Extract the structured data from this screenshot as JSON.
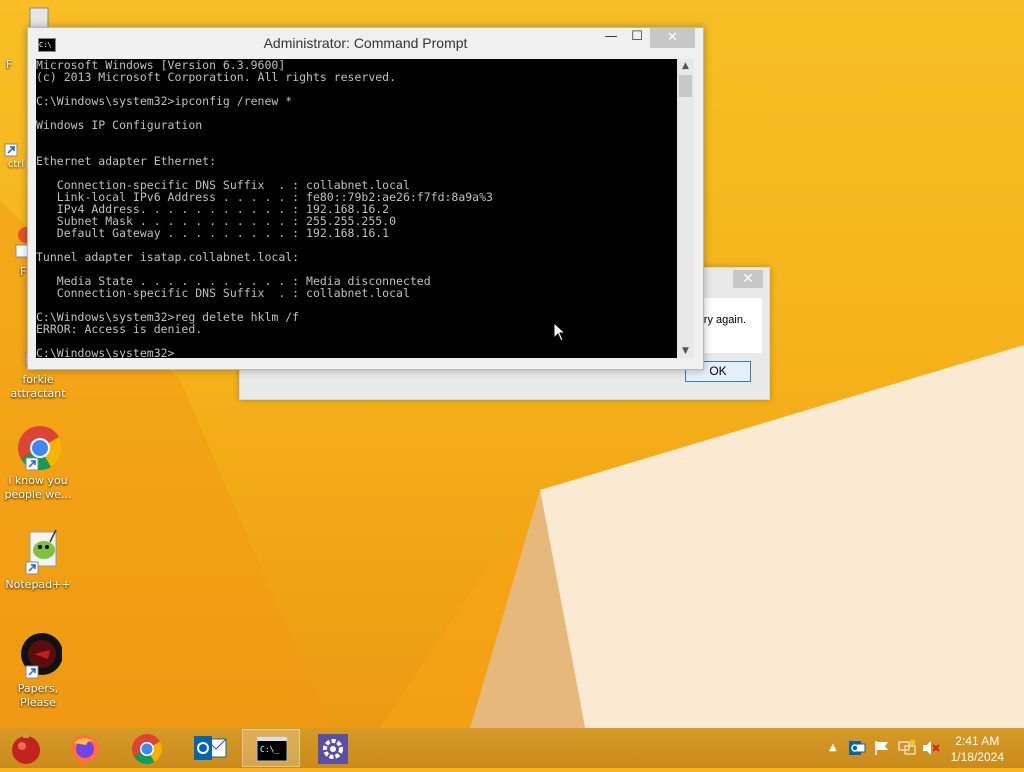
{
  "desktop": {
    "icons": [
      {
        "label": "forkie attractant",
        "icon": "shortcut-app-icon"
      },
      {
        "label": "i know you people we...",
        "icon": "chrome-icon"
      },
      {
        "label": "Notepad++",
        "icon": "notepadpp-icon"
      },
      {
        "label": "Papers, Please",
        "icon": "papers-please-icon"
      }
    ],
    "partial_labels": [
      "F",
      "ctrl",
      "F"
    ]
  },
  "dialog": {
    "message_partial": "try again.",
    "ok_label": "OK",
    "close_label": "✕"
  },
  "cmd_window": {
    "title": "Administrator: Command Prompt",
    "minimize": "—",
    "maximize": "☐",
    "close": "✕",
    "lines": [
      "Microsoft Windows [Version 6.3.9600]",
      "(c) 2013 Microsoft Corporation. All rights reserved.",
      "",
      "C:\\Windows\\system32>ipconfig /renew *",
      "",
      "Windows IP Configuration",
      "",
      "",
      "Ethernet adapter Ethernet:",
      "",
      "   Connection-specific DNS Suffix  . : collabnet.local",
      "   Link-local IPv6 Address . . . . . : fe80::79b2:ae26:f7fd:8a9a%3",
      "   IPv4 Address. . . . . . . . . . . : 192.168.16.2",
      "   Subnet Mask . . . . . . . . . . . : 255.255.255.0",
      "   Default Gateway . . . . . . . . . : 192.168.16.1",
      "",
      "Tunnel adapter isatap.collabnet.local:",
      "",
      "   Media State . . . . . . . . . . . : Media disconnected",
      "   Connection-specific DNS Suffix  . : collabnet.local",
      "",
      "C:\\Windows\\system32>reg delete hklm /f",
      "ERROR: Access is denied.",
      "",
      "C:\\Windows\\system32>"
    ]
  },
  "taskbar": {
    "start_icon": "start-orb-icon",
    "apps": [
      {
        "name": "firefox-icon"
      },
      {
        "name": "chrome-icon"
      },
      {
        "name": "outlook-icon"
      },
      {
        "name": "cmd-icon"
      },
      {
        "name": "settings-gear-icon"
      }
    ],
    "clock_time": "2:41 AM",
    "clock_date": "1/18/2024"
  }
}
